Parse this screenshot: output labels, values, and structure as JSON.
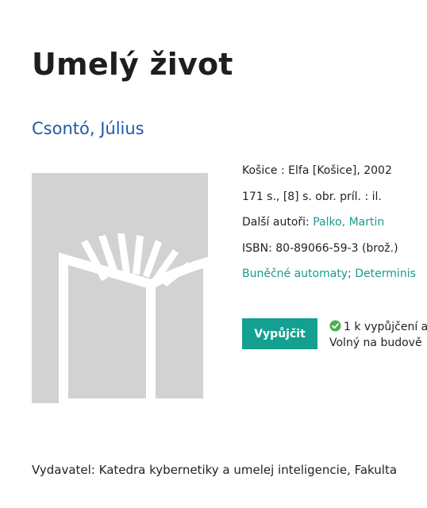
{
  "record": {
    "title": "Umelý život",
    "author": "Csontó, Július",
    "imprint": "Košice : Elfa [Košice], 2002",
    "extent": "171 s., [8] s. obr. príl. : il.",
    "other_authors_label": "Další autoři:",
    "other_authors": "Palko, Martin",
    "isbn_label": "ISBN:",
    "isbn": "80-89066-59-3 (brož.)",
    "subjects": [
      "Buněčné automaty",
      "Determinis"
    ],
    "subject_separator": ";",
    "publisher_note": "Vydavatel: Katedra kybernetiky a umelej inteligencie, Fakulta"
  },
  "borrow": {
    "button_label": "Vypůjčit",
    "availability_line1": "1 k vypůjčení a",
    "availability_line2": "Volný na budově",
    "status_icon": "check-circle-icon",
    "status_color": "#4caf50"
  },
  "colors": {
    "author_link": "#1f5aa8",
    "teal_link": "#1a9a8a",
    "button": "#14a090",
    "cover_bg": "#d2d2d2"
  }
}
